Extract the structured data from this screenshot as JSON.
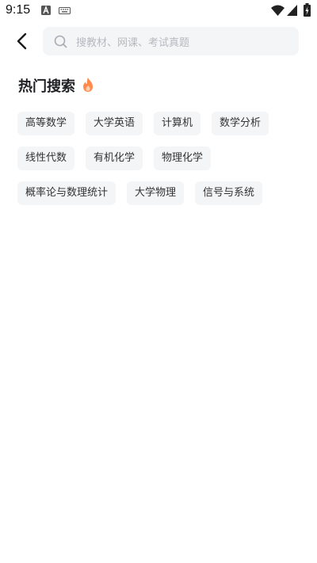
{
  "status_bar": {
    "time": "9:15",
    "icons": [
      "keyboard-icon-a",
      "keyboard-icon",
      "wifi-icon",
      "signal-icon",
      "battery-charging-icon"
    ]
  },
  "header": {
    "back_icon": "chevron-left-icon",
    "search": {
      "icon": "search-icon",
      "placeholder": "搜教材、网课、考试真题"
    }
  },
  "hot_search": {
    "title": "热门搜索",
    "title_icon": "fire-icon",
    "rows": [
      [
        "高等数学",
        "大学英语",
        "计算机",
        "数学分析"
      ],
      [
        "线性代数",
        "有机化学",
        "物理化学"
      ],
      [
        "概率论与数理统计",
        "大学物理",
        "信号与系统"
      ]
    ]
  },
  "colors": {
    "background": "#ffffff",
    "tag_background": "#f4f5f7",
    "placeholder": "#b6b9bf",
    "fire_outer": "#ff8a4c",
    "fire_inner": "#ffd0b0"
  }
}
